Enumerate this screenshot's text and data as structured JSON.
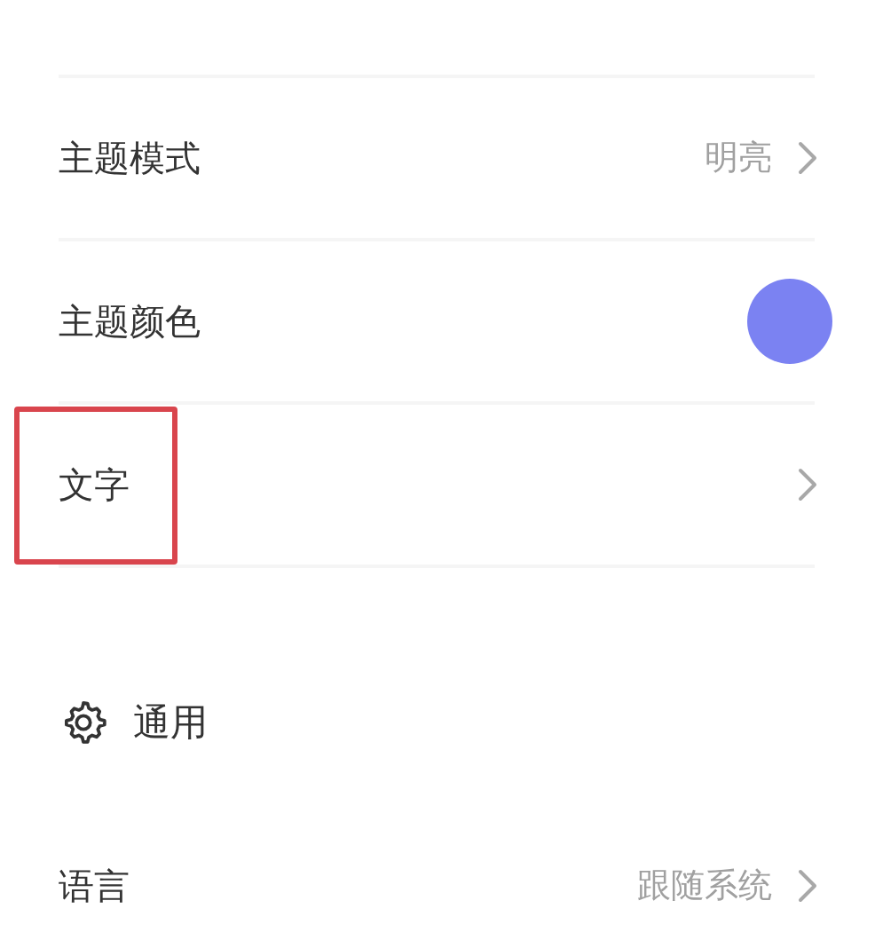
{
  "sections": [
    {
      "items": [
        {
          "kind": "link",
          "label": "主题模式",
          "value": "明亮",
          "highlighted": false
        },
        {
          "kind": "color",
          "label": "主题颜色",
          "color": "#7b82f2",
          "highlighted": false
        },
        {
          "kind": "link",
          "label": "文字",
          "highlighted": true
        }
      ]
    },
    {
      "title": "通用",
      "items": [
        {
          "kind": "link",
          "label": "语言",
          "value": "跟随系统",
          "highlighted": false
        }
      ]
    }
  ]
}
